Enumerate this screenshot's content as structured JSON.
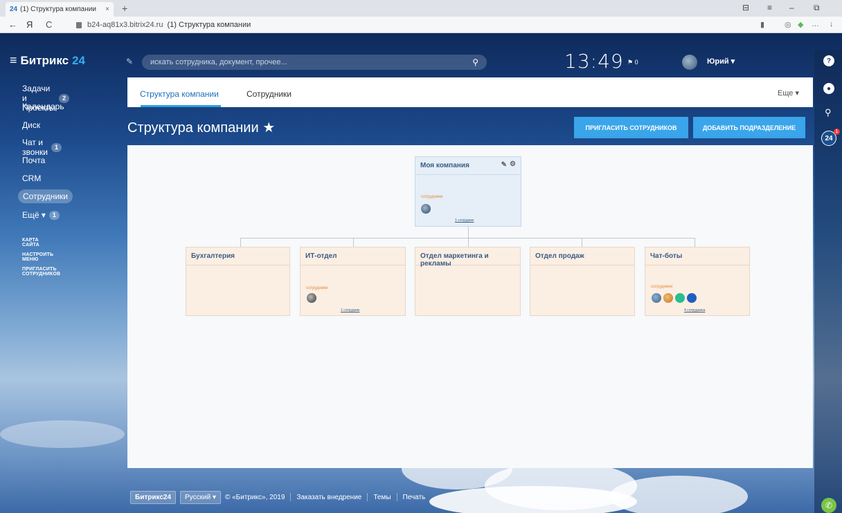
{
  "browser": {
    "tab_icon": "24",
    "tab_title": "(1) Структура компании",
    "tab_close": "×",
    "new_tab": "+",
    "url_host": "b24-aq81x3.bitrix24.ru",
    "url_title": "(1) Структура компании",
    "nav_back": "←",
    "nav_yandex": "Я",
    "nav_reload": "C"
  },
  "header": {
    "menu_icon": "≡",
    "logo_text": "Битрикс",
    "logo_num": "24",
    "search_placeholder": "искать сотрудника, документ, прочее...",
    "time": "13:49",
    "flag_count": "0",
    "user_name": "Юрий"
  },
  "sidebar": {
    "items": [
      {
        "label": "Задачи и Проекты",
        "count": "2"
      },
      {
        "label": "Календарь"
      },
      {
        "label": "Диск"
      },
      {
        "label": "Чат и звонки",
        "count": "1"
      },
      {
        "label": "Почта"
      },
      {
        "label": "CRM"
      },
      {
        "label": "Сотрудники"
      },
      {
        "label": "Ещё",
        "count": "1"
      }
    ],
    "links": [
      "КАРТА САЙТА",
      "НАСТРОИТЬ МЕНЮ",
      "ПРИГЛАСИТЬ СОТРУДНИКОВ"
    ]
  },
  "tabs": {
    "structure": "Структура компании",
    "employees": "Сотрудники",
    "more": "Еще"
  },
  "page": {
    "title": "Структура компании",
    "invite_button": "ПРИГЛАСИТЬ СОТРУДНИКОВ",
    "add_button": "ДОБАВИТЬ ПОДРАЗДЕЛЕНИЕ"
  },
  "org": {
    "root": {
      "name": "Моя компания",
      "label": "сотрудники",
      "members": "1 сотрудник"
    },
    "departments": [
      {
        "name": "Бухгалтерия"
      },
      {
        "name": "ИТ-отдел",
        "label": "сотрудники",
        "members": "1 сотрудник"
      },
      {
        "name": "Отдел маркетинга и рекламы"
      },
      {
        "name": "Отдел продаж"
      },
      {
        "name": "Чат-боты",
        "label": "сотрудники",
        "members": "4 сотрудника"
      }
    ]
  },
  "right_panel": {
    "badge_24": "24",
    "badge_count": "1"
  },
  "footer": {
    "brand": "Битрикс24",
    "language": "Русский",
    "copyright": "© «Битрикс», 2019",
    "order": "Заказать внедрение",
    "themes": "Темы",
    "print": "Печать"
  },
  "colors": {
    "accent": "#3aa5ea",
    "tab_active": "#1f6fb9",
    "dept_bg": "#fbeee3"
  }
}
